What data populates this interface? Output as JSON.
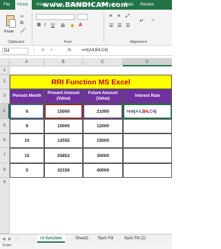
{
  "ribbon": {
    "tabs": [
      "File",
      "Home",
      "Insert",
      "Draw",
      "Page Layout",
      "Formulas",
      "Data",
      "Review"
    ],
    "watermark": "www.BANDICAM.com",
    "groups": {
      "clipboard": "Clipboard",
      "font": "Font",
      "alignment": "Alignment"
    },
    "paste_label": "Paste"
  },
  "formula_bar": {
    "name_box": "D4",
    "fx": "fx",
    "formula": "=rri(A4,B4,C4)"
  },
  "grid": {
    "columns": [
      "A",
      "B",
      "C",
      "D"
    ],
    "rows": [
      "1",
      "2",
      "3",
      "4",
      "5",
      "6",
      "7",
      "8",
      "9"
    ],
    "title": "RRI Function MS Excel",
    "headers": [
      "Periods Month",
      "Present Amount (Value)",
      "Future Amount (Value)",
      "Interest Rate"
    ],
    "data": [
      [
        "6",
        "15000",
        "21000"
      ],
      [
        "9",
        "10000",
        "12000"
      ],
      [
        "10",
        "12555",
        "15000"
      ],
      [
        "15",
        "25852",
        "30000"
      ],
      [
        "5",
        "32156",
        "40000"
      ]
    ],
    "active_formula": {
      "prefix": "=rri(",
      "a": "A4",
      "sep1": ",",
      "b": "B4",
      "sep2": ",",
      "c": "C4",
      "suffix": ")"
    }
  },
  "sheets": {
    "tabs": [
      "rri function",
      "Sheet2",
      "flash Fill",
      "flash Fill (2)"
    ],
    "active": "rri function"
  },
  "status": "Enter",
  "colors": {
    "brand": "#217346",
    "title_fill": "#ffff00",
    "title_text": "#c00000",
    "header_fill": "#7030a0"
  }
}
